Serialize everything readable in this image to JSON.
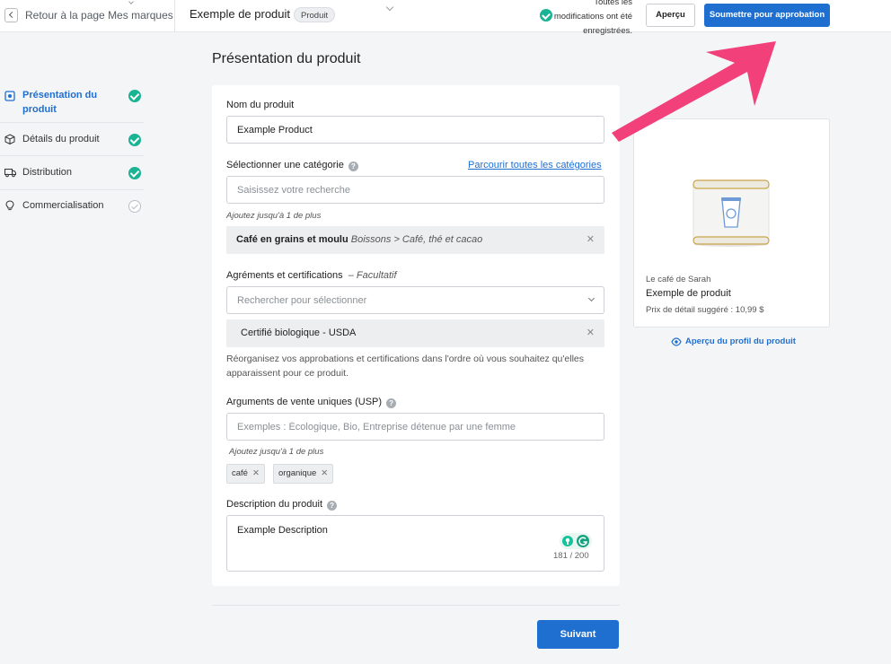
{
  "header": {
    "back_label": "Retour à la page Mes marques",
    "product_title": "Exemple de produit",
    "product_badge": "Produit",
    "saved_status": "Toutes les modifications ont été enregistrées.",
    "preview_label": "Aperçu",
    "submit_label": "Soumettre pour approbation"
  },
  "sidebar": {
    "items": [
      {
        "label": "Présentation du produit",
        "icon": "overview-icon",
        "status": "complete",
        "active": true
      },
      {
        "label": "Détails du produit",
        "icon": "box-icon",
        "status": "complete",
        "active": false
      },
      {
        "label": "Distribution",
        "icon": "truck-icon",
        "status": "complete",
        "active": false
      },
      {
        "label": "Commercialisation",
        "icon": "lightbulb-icon",
        "status": "pending",
        "active": false
      }
    ]
  },
  "main": {
    "section_title": "Présentation du produit",
    "name": {
      "label": "Nom du produit",
      "value": "Example Product"
    },
    "category": {
      "label": "Sélectionner une catégorie",
      "browse_link": "Parcourir toutes les catégories",
      "placeholder": "Saisissez votre recherche",
      "hint": "Ajoutez jusqu'à 1 de plus",
      "selected_name": "Café en grains et moulu",
      "selected_path": "Boissons > Café, thé et cacao"
    },
    "certifications": {
      "label": "Agréments et certifications",
      "optional": "– Facultatif",
      "placeholder": "Rechercher pour sélectionner",
      "selected": "Certifié biologique - USDA",
      "helper": "Réorganisez vos approbations et certifications dans l'ordre où vous souhaitez qu'elles apparaissent pour ce produit."
    },
    "usp": {
      "label": "Arguments de vente uniques (USP)",
      "placeholder": "Exemples : Écologique, Bio, Entreprise détenue par une femme",
      "hint": "Ajoutez jusqu'à 1 de plus",
      "tags": [
        "café",
        "organique"
      ]
    },
    "description": {
      "label": "Description du produit",
      "value": "Example Description",
      "counter": "181 / 200"
    },
    "next_label": "Suivant"
  },
  "preview": {
    "brand": "Le café de Sarah",
    "product_name": "Exemple de produit",
    "price": "Prix de détail suggéré : 10,99 $",
    "profile_link": "Aperçu du profil du produit"
  },
  "colors": {
    "primary": "#1f6fd1",
    "success": "#1ab394",
    "annotation_arrow": "#f2407a"
  }
}
